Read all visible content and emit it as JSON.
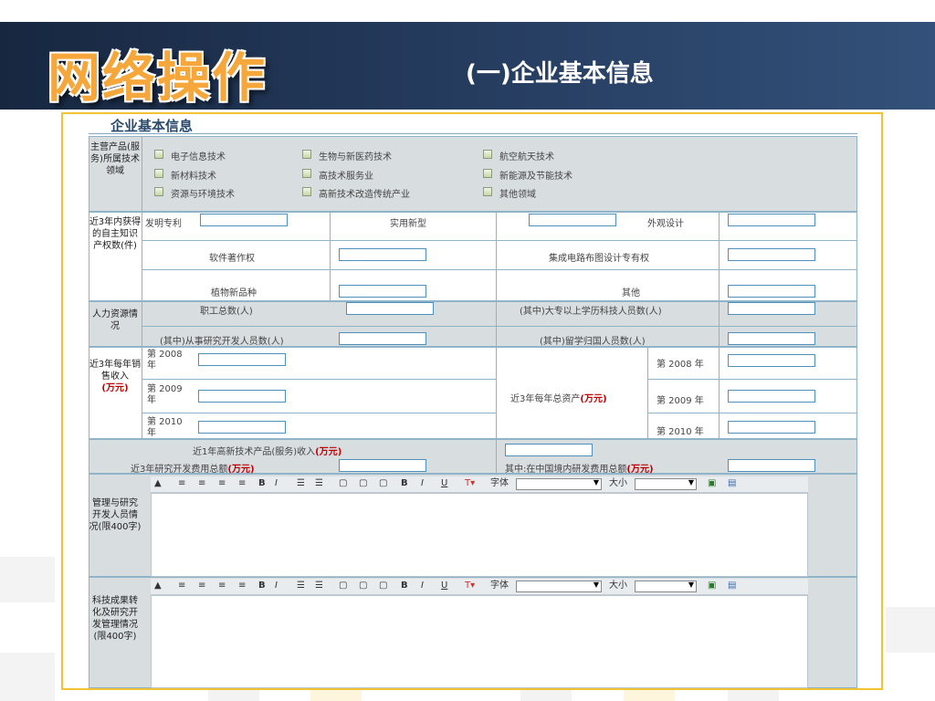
{
  "slide": {
    "title": "网络操作",
    "subtitle": "(一)企业基本信息"
  },
  "form": {
    "title": "企业基本信息",
    "main_field_label": "主营产品(服务)所属技术领域",
    "tech_options": [
      "电子信息技术",
      "生物与新医药技术",
      "航空航天技术",
      "新材料技术",
      "高技术服务业",
      "新能源及节能技术",
      "资源与环境技术",
      "高新技术改造传统产业",
      "其他领域"
    ],
    "ip": {
      "label": "近3年内获得的自主知识产权数(件)",
      "invention": "发明专利",
      "utility": "实用新型",
      "design": "外观设计",
      "software": "软件著作权",
      "ic_layout": "集成电路布图设计专有权",
      "plant": "植物新品种",
      "other": "其他"
    },
    "hr": {
      "label": "人力资源情况",
      "total": "职工总数(人)",
      "college": "(其中)大专以上学历科技人员数(人)",
      "rd": "(其中)从事研究开发人员数(人)",
      "returnee": "(其中)留学归国人员数(人)"
    },
    "sales": {
      "label_main": "近3年每年销售收入",
      "label_unit": "(万元)",
      "year_2008": "第 2008 年",
      "year_2009": "第 2009 年",
      "year_2010": "第 2010 年"
    },
    "assets": {
      "label_main": "近3年每年总资产",
      "label_unit": "(万元)",
      "year_2008": "第 2008 年",
      "year_2009": "第 2009 年",
      "year_2010": "第 2010 年"
    },
    "high_tech_income": {
      "main": "近1年高新技术产品(服务)收入",
      "unit": "(万元)"
    },
    "rd_total": {
      "main": "近3年研究开发费用总额",
      "unit": "(万元)"
    },
    "rd_domestic": {
      "main": "其中:在中国境内研发费用总额",
      "unit": "(万元)"
    },
    "mgmt": {
      "label": "管理与研究开发人员情况(限400字)"
    },
    "achievement": {
      "label": "科技成果转化及研究开发管理情况(限400字)"
    },
    "toolbar": {
      "font_label": "字体",
      "size_label": "大小",
      "bold": "B",
      "italic": "I",
      "underline": "U"
    }
  },
  "colors": {
    "header_bg": "#243a5c",
    "title_orange": "#f6a73c",
    "frame_border": "#f1c232",
    "input_border": "#4d90bb",
    "unit_red": "#c00000"
  }
}
